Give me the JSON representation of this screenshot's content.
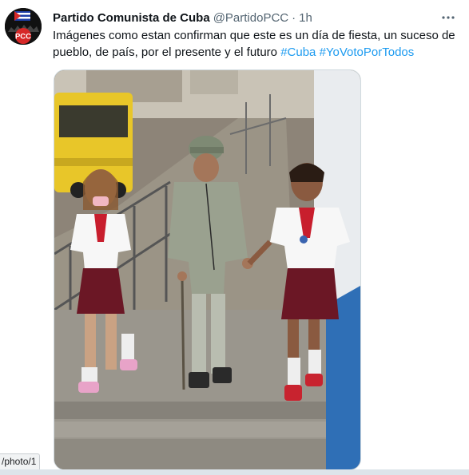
{
  "tweet": {
    "author": {
      "display_name": "Partido Comunista de Cuba",
      "handle": "@PartidoPCC",
      "avatar_text": "PCC"
    },
    "separator": "·",
    "time": "1h",
    "text_main": "Imágenes como estan confirman que este es un día de fiesta, un suceso de pueblo, de país, por el presente y el futuro",
    "hashtags": [
      "#Cuba",
      "#YoVotoPorTodos"
    ]
  },
  "status_url": "/photo/1",
  "icons": {
    "more": "more-horizontal-icon",
    "avatar": "pcc-logo"
  },
  "colors": {
    "link": "#1d9bf0",
    "text_primary": "#0f1419",
    "text_secondary": "#536471"
  }
}
